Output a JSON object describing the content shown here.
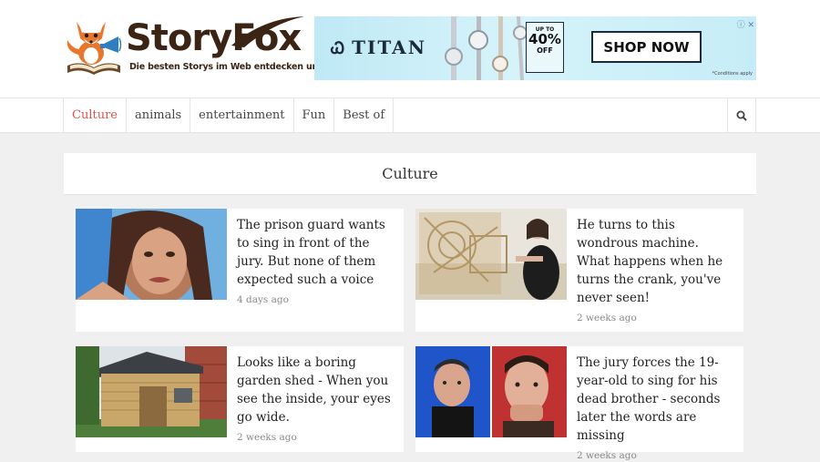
{
  "header": {
    "logo_word": "StoryFox",
    "logo_tagline": "Die besten Storys im Web entdecken und teilen."
  },
  "ad": {
    "brand": "TITAN",
    "offer_upto": "UP TO",
    "offer_percent": "40%",
    "offer_off": "OFF",
    "cta": "SHOP NOW",
    "conditions": "*Conditions apply"
  },
  "nav": {
    "items": [
      {
        "label": "Culture",
        "active": true
      },
      {
        "label": "animals"
      },
      {
        "label": "entertainment"
      },
      {
        "label": "Fun"
      },
      {
        "label": "Best of"
      }
    ]
  },
  "section": {
    "title": "Culture"
  },
  "articles": [
    {
      "title": "The prison guard wants to sing in front of the jury. But none of them expected such a voice",
      "date": "4 days ago"
    },
    {
      "title": "He turns to this wondrous machine. What happens when he turns the crank, you've never seen!",
      "date": "2 weeks ago"
    },
    {
      "title": "Looks like a boring garden shed - When you see the inside, your eyes go wide.",
      "date": "2 weeks ago"
    },
    {
      "title": "The jury forces the 19-year-old to sing for his dead brother - seconds later the words are missing",
      "date": "2 weeks ago"
    }
  ],
  "colors": {
    "accent": "#d9534f",
    "brand_brown": "#3b2414"
  }
}
